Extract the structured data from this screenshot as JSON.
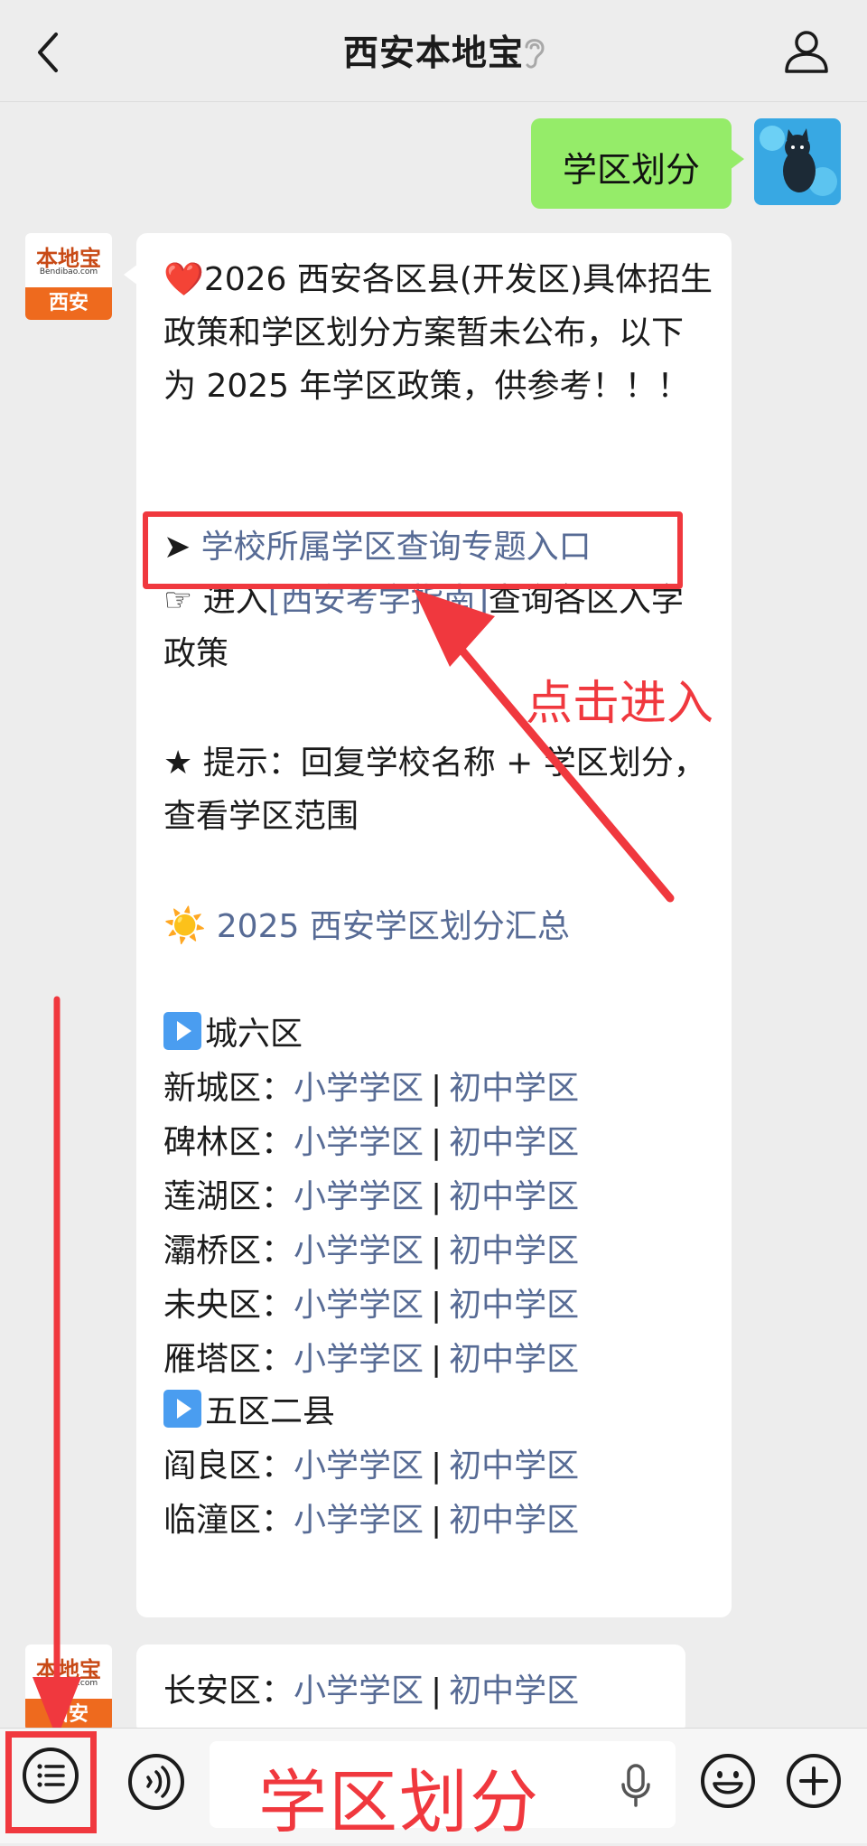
{
  "header": {
    "title": "西安本地宝"
  },
  "user_message": {
    "text": "学区划分"
  },
  "bot_avatar": {
    "logo_top": "本地宝",
    "logo_sub": "Bendibao.com",
    "logo_city": "西安"
  },
  "message": {
    "intro": "2026 西安各区县(开发区)具体招生政策和学区划分方案暂未公布，以下为 2025 年学区政策，供参考！！！",
    "heart": "❤️",
    "entry_arrow": "➤",
    "entry_link": "学校所属学区查询专题入口",
    "guide_prefix": "☞ 进入",
    "guide_link": "[西安考学指南]",
    "guide_suffix": "查询各区入学政策",
    "tip": "★ 提示：回复学校名称 + 学区划分，查看学区范围",
    "summary_icon": "☀️",
    "summary_link": "2025 西安学区划分汇总",
    "group1_title": "城六区",
    "group2_title": "五区二县",
    "separator": "|",
    "primary_label": "小学学区",
    "middle_label": "初中学区",
    "districts1": [
      "新城区：",
      "碑林区：",
      "莲湖区：",
      "灞桥区：",
      "未央区：",
      "雁塔区："
    ],
    "districts2": [
      "阎良区：",
      "临潼区："
    ],
    "district3": "长安区："
  },
  "annotation": {
    "click_hint": "点击进入"
  },
  "input": {
    "text": "学区划分"
  },
  "colors": {
    "link": "#576b95",
    "bubble_green": "#95ec69",
    "highlight_red": "#f0383e"
  }
}
